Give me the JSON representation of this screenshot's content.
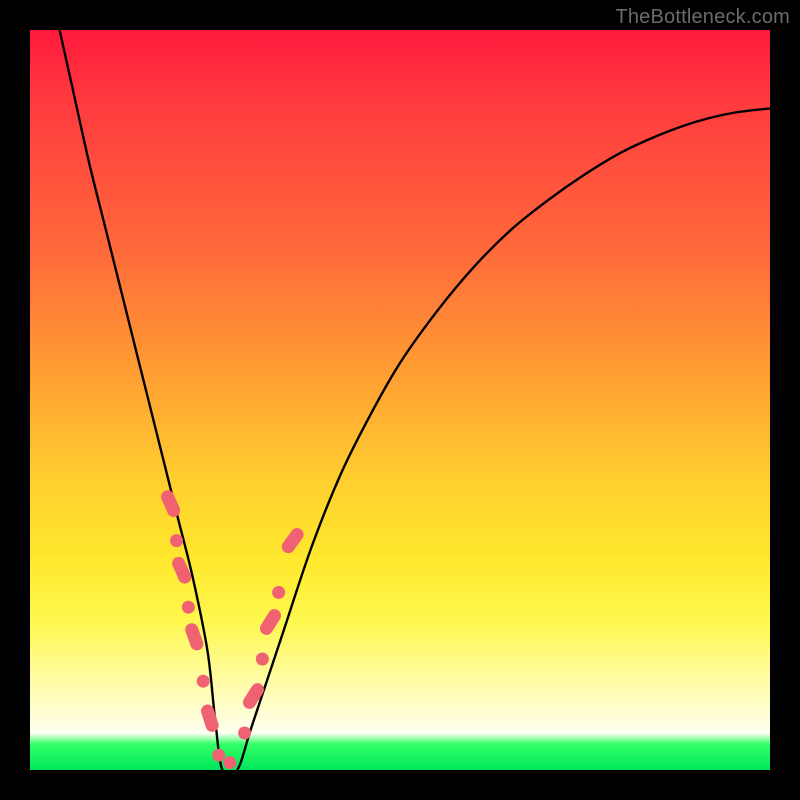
{
  "watermark": {
    "text": "TheBottleneck.com"
  },
  "chart_data": {
    "type": "line",
    "title": "",
    "xlabel": "",
    "ylabel": "",
    "xlim": [
      0,
      100
    ],
    "ylim": [
      0,
      100
    ],
    "series": [
      {
        "name": "curve",
        "x": [
          4,
          6,
          8,
          10,
          12,
          14,
          16,
          18,
          20,
          22,
          24,
          25,
          26,
          28,
          30,
          34,
          38,
          42,
          46,
          50,
          55,
          60,
          65,
          70,
          75,
          80,
          85,
          90,
          95,
          100
        ],
        "values": [
          100,
          91,
          82,
          74,
          66,
          58,
          50,
          42,
          34,
          26,
          16,
          7,
          0,
          0,
          6,
          18,
          30,
          40,
          48,
          55,
          62,
          68,
          73,
          77,
          80.5,
          83.5,
          85.8,
          87.6,
          88.8,
          89.4
        ]
      }
    ],
    "markers": {
      "name": "highlighted-points",
      "color": "#f06171",
      "points": [
        {
          "x": 19.0,
          "y": 36,
          "kind": "pill",
          "angle": 66
        },
        {
          "x": 19.8,
          "y": 31,
          "kind": "dot"
        },
        {
          "x": 20.5,
          "y": 27,
          "kind": "pill",
          "angle": 66
        },
        {
          "x": 21.4,
          "y": 22,
          "kind": "dot"
        },
        {
          "x": 22.2,
          "y": 18,
          "kind": "pill",
          "angle": 70
        },
        {
          "x": 23.4,
          "y": 12,
          "kind": "dot"
        },
        {
          "x": 24.3,
          "y": 7,
          "kind": "pill",
          "angle": 72
        },
        {
          "x": 25.5,
          "y": 2,
          "kind": "dot"
        },
        {
          "x": 27.0,
          "y": 1,
          "kind": "dot"
        },
        {
          "x": 29.0,
          "y": 5,
          "kind": "dot"
        },
        {
          "x": 30.2,
          "y": 10,
          "kind": "pill",
          "angle": -58
        },
        {
          "x": 31.4,
          "y": 15,
          "kind": "dot"
        },
        {
          "x": 32.5,
          "y": 20,
          "kind": "pill",
          "angle": -58
        },
        {
          "x": 33.6,
          "y": 24,
          "kind": "dot"
        },
        {
          "x": 35.5,
          "y": 31,
          "kind": "pill",
          "angle": -54
        }
      ]
    },
    "gradient_stops": [
      {
        "pct": 0,
        "color": "#ff1a3c"
      },
      {
        "pct": 30,
        "color": "#ff6a3a"
      },
      {
        "pct": 62,
        "color": "#ffd22e"
      },
      {
        "pct": 92,
        "color": "#fffed0"
      },
      {
        "pct": 97,
        "color": "#33ff66"
      },
      {
        "pct": 100,
        "color": "#00e65c"
      }
    ]
  }
}
